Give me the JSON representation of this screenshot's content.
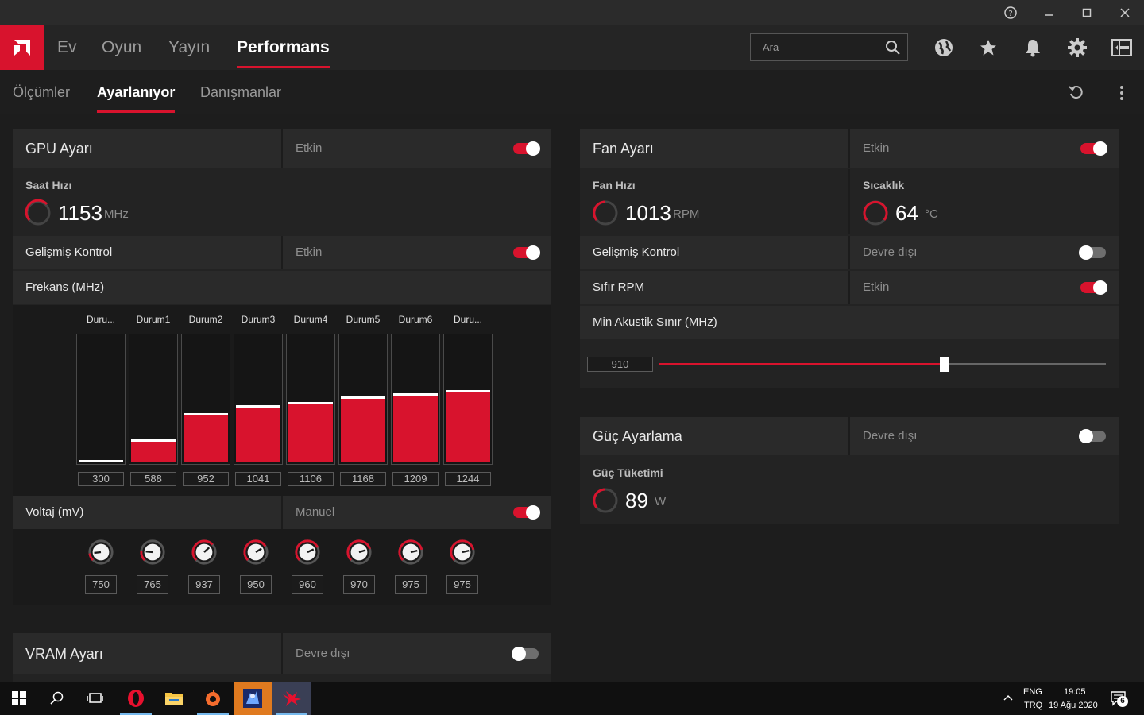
{
  "titlebar": {
    "help_icon": "help-circle-icon",
    "minimize_icon": "minimize-icon",
    "maximize_icon": "maximize-icon",
    "close_icon": "close-icon"
  },
  "nav": {
    "tabs": [
      {
        "label": "Ev"
      },
      {
        "label": "Oyun"
      },
      {
        "label": "Yayın"
      },
      {
        "label": "Performans"
      }
    ],
    "active_tab": "Performans",
    "search_placeholder": "Ara"
  },
  "subnav": {
    "tabs": [
      {
        "label": "Ölçümler"
      },
      {
        "label": "Ayarlanıyor"
      },
      {
        "label": "Danışmanlar"
      }
    ],
    "active_tab": "Ayarlanıyor"
  },
  "gpu": {
    "title": "GPU Ayarı",
    "state": "Etkin",
    "clock_label": "Saat Hızı",
    "clock_value": "1153",
    "clock_unit": "MHz",
    "advanced_label": "Gelişmiş Kontrol",
    "advanced_state": "Etkin",
    "freq_label": "Frekans (MHz)",
    "stages": [
      {
        "label": "Duru...",
        "value": "300",
        "level": 0.0
      },
      {
        "label": "Durum1",
        "value": "588",
        "level": 0.18
      },
      {
        "label": "Durum2",
        "value": "952",
        "level": 0.39
      },
      {
        "label": "Durum3",
        "value": "1041",
        "level": 0.45
      },
      {
        "label": "Durum4",
        "value": "1106",
        "level": 0.48
      },
      {
        "label": "Durum5",
        "value": "1168",
        "level": 0.52
      },
      {
        "label": "Durum6",
        "value": "1209",
        "level": 0.55
      },
      {
        "label": "Duru...",
        "value": "1244",
        "level": 0.57
      }
    ],
    "voltage_label": "Voltaj (mV)",
    "voltage_state": "Manuel",
    "voltages": [
      "750",
      "765",
      "937",
      "950",
      "960",
      "970",
      "975",
      "975"
    ]
  },
  "vram": {
    "title": "VRAM Ayarı",
    "state": "Devre dışı"
  },
  "fan": {
    "title": "Fan Ayarı",
    "state": "Etkin",
    "speed_label": "Fan Hızı",
    "speed_value": "1013",
    "speed_unit": "RPM",
    "temp_label": "Sıcaklık",
    "temp_value": "64",
    "temp_unit": "°C",
    "advanced_label": "Gelişmiş Kontrol",
    "advanced_state": "Devre dışı",
    "zero_rpm_label": "Sıfır RPM",
    "zero_rpm_state": "Etkin",
    "acoustic_label": "Min Akustik Sınır (MHz)",
    "acoustic_value": "910",
    "acoustic_level": 0.64
  },
  "power": {
    "title": "Güç Ayarlama",
    "state": "Devre dışı",
    "consumption_label": "Güç Tüketimi",
    "consumption_value": "89",
    "consumption_unit": "W"
  },
  "taskbar": {
    "lang_top": "ENG",
    "lang_bottom": "TRQ",
    "time": "19:05",
    "date": "19 Ağu 2020",
    "notification_count": "6"
  },
  "colors": {
    "accent": "#d8132d",
    "panel": "#2a2a2a",
    "background": "#1d1d1d"
  }
}
